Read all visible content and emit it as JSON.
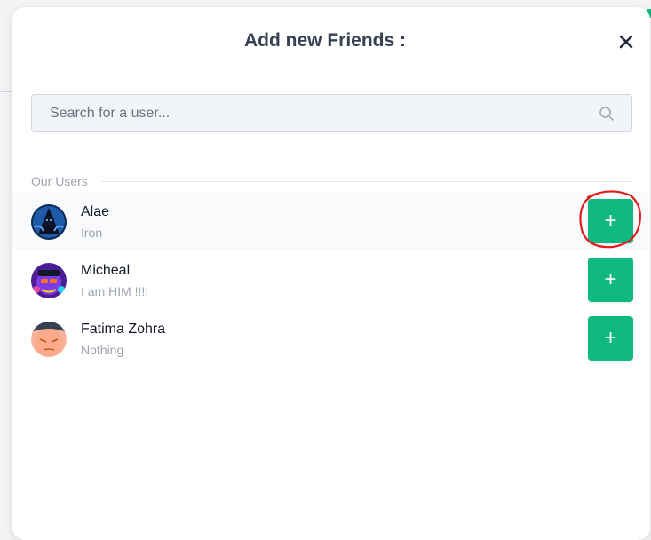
{
  "dialog": {
    "title": "Add new Friends :",
    "close_icon": "close-icon"
  },
  "search": {
    "placeholder": "Search for a user...",
    "value": "",
    "icon": "search-icon"
  },
  "section": {
    "label": "Our Users"
  },
  "users": [
    {
      "name": "Alae",
      "status": "Iron",
      "avatar": "hooded-figure-avatar",
      "add_label": "+"
    },
    {
      "name": "Micheal",
      "status": "I am HIM !!!!",
      "avatar": "colorful-character-avatar",
      "add_label": "+"
    },
    {
      "name": "Fatima Zohra",
      "status": "Nothing",
      "avatar": "face-avatar",
      "add_label": "+"
    }
  ],
  "colors": {
    "accent": "#10b981",
    "annotation": "#e11d1d"
  }
}
